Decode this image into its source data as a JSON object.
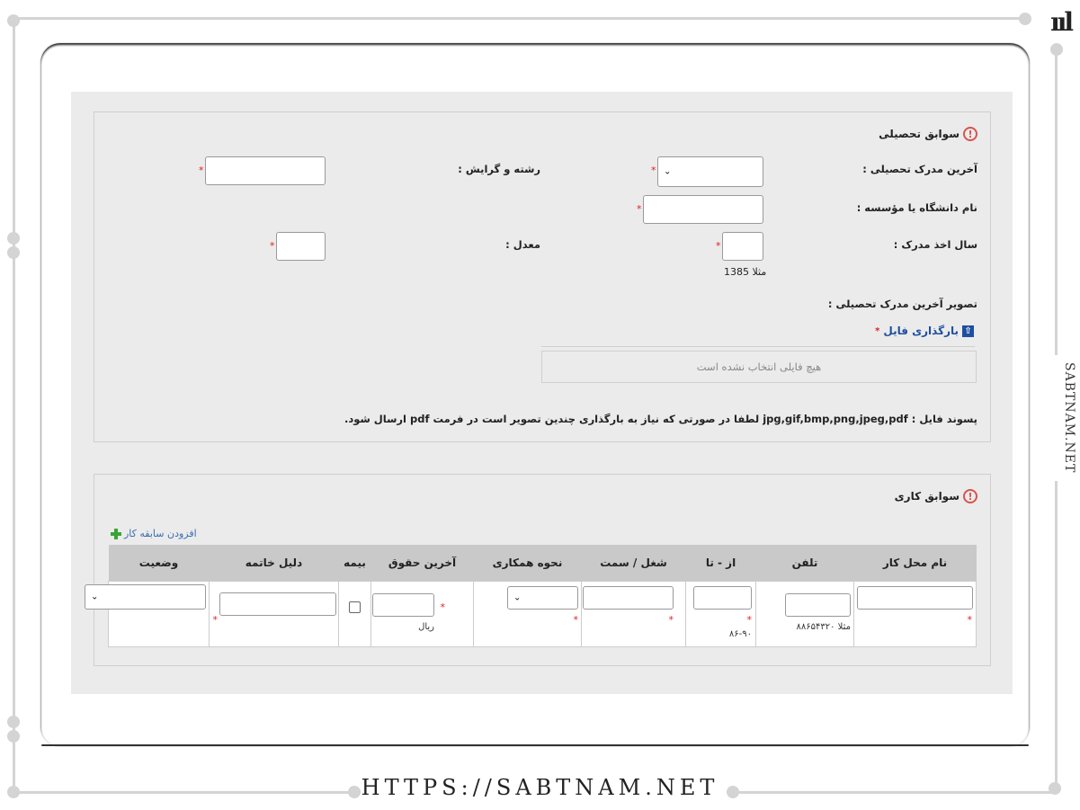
{
  "watermark": {
    "side_text": "SABTNAM.NET",
    "footer_url": "HTTPS://SABTNAM.NET",
    "corner_logo": "ııl"
  },
  "education": {
    "title": "سوابق تحصیلی",
    "last_degree_label": "آخرین مدرک تحصیلی :",
    "field_label": "رشته و گرایش :",
    "university_label": "نام دانشگاه یا مؤسسه :",
    "year_label": "سال اخذ مدرک :",
    "year_hint": "مثلا 1385",
    "gpa_label": "معدل :",
    "image_label": "تصویر آخرین مدرک تحصیلی :",
    "upload_label": "بارگذاری فایل",
    "no_file_text": "هیچ فایلی انتخاب نشده است",
    "file_note": "پسوند فایل : jpg,gif,bmp,png,jpeg,pdf لطفا در صورتی که نیاز به بارگذاری چندین تصویر است در فرمت pdf ارسال شود."
  },
  "work": {
    "title": "سوابق کاری",
    "add_label": "افزودن سابقه کار",
    "columns": [
      "نام محل کار",
      "تلفن",
      "از - تا",
      "شغل / سمت",
      "نحوه همکاری",
      "آخرین حقوق",
      "بیمه",
      "دلیل خاتمه",
      "وضعیت"
    ],
    "phone_hint": "مثلا ۸۸۶۵۴۳۲۰",
    "range_hint": "۸۶-۹۰",
    "salary_unit": "ریال"
  },
  "required_mark": "*"
}
